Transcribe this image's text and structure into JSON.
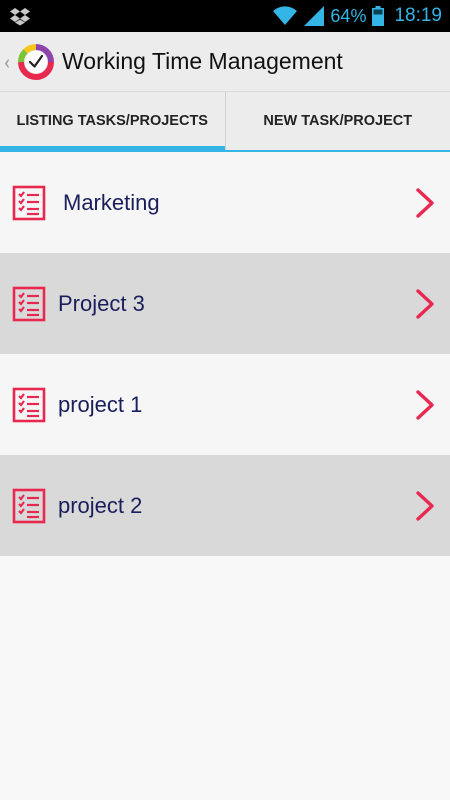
{
  "status_bar": {
    "battery_percent": "64%",
    "time": "18:19",
    "icons": [
      "dropbox-icon",
      "wifi-icon",
      "signal-icon",
      "battery-icon"
    ]
  },
  "action_bar": {
    "title": "Working Time Management",
    "icons": [
      "up-caret-icon",
      "app-logo-icon"
    ]
  },
  "tabs": [
    {
      "label": "LISTING TASKS/PROJECTS",
      "active": true
    },
    {
      "label": "NEW TASK/PROJECT",
      "active": false
    }
  ],
  "projects": [
    {
      "label": "Marketing"
    },
    {
      "label": "Project 3"
    },
    {
      "label": "project 1"
    },
    {
      "label": "project 2"
    }
  ],
  "colors": {
    "accent": "#33b5e5",
    "icon_red": "#e8284f",
    "text_navy": "#1a1f5c"
  }
}
